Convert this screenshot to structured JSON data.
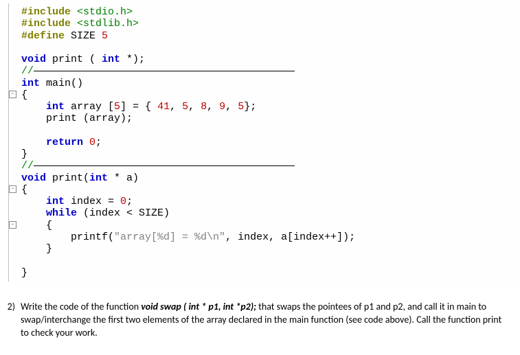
{
  "code": {
    "l1a": "#include",
    "l1b": " <stdio.h>",
    "l2a": "#include",
    "l2b": " <stdlib.h>",
    "l3a": "#define",
    "l3b": " SIZE",
    "l3c": " 5",
    "l4_void": "void",
    "l4_rest": " print ( ",
    "l4_int": "int",
    "l4_end": " *);",
    "l5_cmt": "//",
    "l6_int": "int",
    "l6_main": " main()",
    "l7_brace": "{",
    "l8_indent": "    ",
    "l8_int": "int",
    "l8_arr": " array [",
    "l8_5": "5",
    "l8_eq": "] = { ",
    "l8_v1": "41",
    "l8_c": ", ",
    "l8_v2": "5",
    "l8_v3": "8",
    "l8_v4": "9",
    "l8_v5": "5",
    "l8_end": "};",
    "l9_indent": "    ",
    "l9_txt": "print (array);",
    "l10_blank": " ",
    "l11_indent": "    ",
    "l11_ret": "return",
    "l11_zero": " 0",
    "l11_semi": ";",
    "l12_brace": "}",
    "l13_cmt": "//",
    "l14_void": "void",
    "l14_pr": " print(",
    "l14_int": "int",
    "l14_rest": " * a)",
    "l15_brace": "{",
    "l16_indent": "    ",
    "l16_int": "int",
    "l16_idx": " index = ",
    "l16_zero": "0",
    "l16_semi": ";",
    "l17_indent": "    ",
    "l17_while": "while",
    "l17_cond": " (index < SIZE)",
    "l18_indent": "    ",
    "l18_brace": "{",
    "l19_indent": "        ",
    "l19_pf": "printf(",
    "l19_str": "\"array[%d] = %d\\n\"",
    "l19_rest": ", index, a[index++]);",
    "l20_indent": "    ",
    "l20_brace": "}",
    "l21_blank": " ",
    "l22_brace": "}"
  },
  "question": {
    "num": "2)",
    "t1": "Write the code of the function ",
    "sig": "void swap ( int * p1, int *p2);",
    "t2": " that swaps the pointees of p1 and p2, and call it in main to swap/interchange the first two elements of the array declared in the main function (see code above). Call the function print to check your work."
  }
}
